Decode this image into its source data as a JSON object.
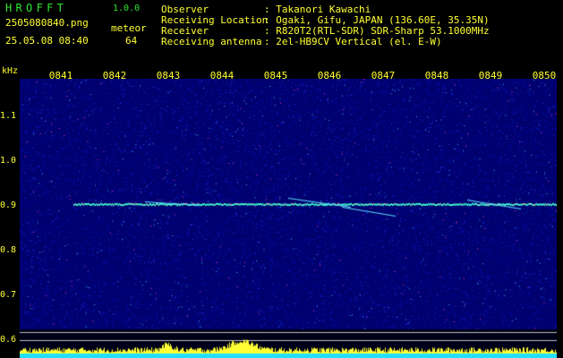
{
  "app": {
    "title": "HROFFT",
    "version": "1.0.0"
  },
  "file": {
    "name": "2505080840.png",
    "datetime": "25.05.08 08:40"
  },
  "meteor": {
    "label": "meteor",
    "count": "64"
  },
  "info": [
    {
      "label": "Observer",
      "value": ": Takanori Kawachi"
    },
    {
      "label": "Receiving Location",
      "value": ": Ogaki, Gifu, JAPAN (136.60E, 35.35N)"
    },
    {
      "label": "Receiver",
      "value": ": R820T2(RTL-SDR) SDR-Sharp 53.1000MHz"
    },
    {
      "label": "Receiving antenna",
      "value": ": 2el-HB9CV Vertical (el. E-W)"
    }
  ],
  "axis": {
    "unit": "kHz",
    "x_ticks": [
      "0841",
      "0842",
      "0843",
      "0844",
      "0845",
      "0846",
      "0847",
      "0848",
      "0849",
      "0850"
    ],
    "y_ticks": [
      "1.1",
      "1.0",
      "0.9",
      "0.8",
      "0.7",
      "0.6"
    ],
    "y_values": [
      1.1,
      1.0,
      0.9,
      0.8,
      0.7,
      0.6
    ]
  },
  "signal": {
    "carrier_khz": 0.905
  },
  "colors": {
    "label": "#ffff33",
    "title": "#2ee82e",
    "noise": "#0000a0",
    "carrier": "#40ffd0",
    "baseline": "#ffff33"
  }
}
